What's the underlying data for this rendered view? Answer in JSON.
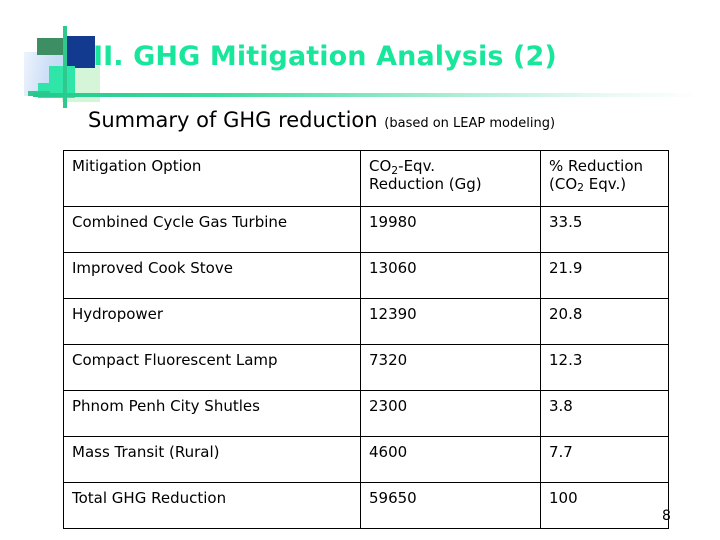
{
  "slide": {
    "title": "II. GHG Mitigation Analysis (2)",
    "page_number": "8",
    "subtitle_main": "Summary of GHG reduction",
    "subtitle_note": "(based on LEAP modeling)"
  },
  "colors": {
    "title_green": "#17e69b",
    "logo_navy": "#123a8f",
    "logo_dark_green": "#3d8f63",
    "logo_mint": "#2fe6a8",
    "logo_pale_green": "#d5f5d8",
    "logo_pale_blue": "#cfe0f7",
    "rule_green": "#22c98c",
    "table_border": "#000000",
    "text": "#000000"
  },
  "table": {
    "headers": {
      "option": "Mitigation Option",
      "reduction_line1": "CO",
      "reduction_sub": "2",
      "reduction_line1_tail": "-Eqv.",
      "reduction_line2": "Reduction (Gg)",
      "percent_line1": "% Reduction",
      "percent_line2_open": "(CO",
      "percent_sub": "2",
      "percent_line2_tail": " Eqv.)"
    },
    "rows": [
      {
        "option": "Combined Cycle Gas Turbine",
        "reduction_gg": "19980",
        "percent_reduction": "33.5"
      },
      {
        "option": "Improved Cook Stove",
        "reduction_gg": "13060",
        "percent_reduction": "21.9"
      },
      {
        "option": "Hydropower",
        "reduction_gg": "12390",
        "percent_reduction": "20.8"
      },
      {
        "option": "Compact Fluorescent Lamp",
        "reduction_gg": "7320",
        "percent_reduction": "12.3"
      },
      {
        "option": "Phnom Penh City Shutles",
        "reduction_gg": "2300",
        "percent_reduction": "3.8"
      },
      {
        "option": "Mass Transit (Rural)",
        "reduction_gg": "4600",
        "percent_reduction": "7.7"
      },
      {
        "option": "Total GHG Reduction",
        "reduction_gg": "59650",
        "percent_reduction": "100"
      }
    ]
  }
}
